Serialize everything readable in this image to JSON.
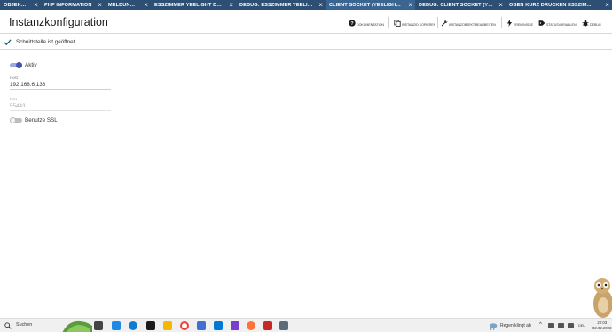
{
  "tabs": [
    {
      "label": "OBJEKTBAUM",
      "active": false
    },
    {
      "label": "PHP INFORMATION",
      "active": false
    },
    {
      "label": "MELDUNGEN",
      "active": false
    },
    {
      "label": "ESSZIMMER YEELIGHT DEVICE",
      "active": false
    },
    {
      "label": "DEBUG: ESSZIMMER YEELIGHT ...",
      "active": false
    },
    {
      "label": "CLIENT SOCKET (YEELIGHTDEV...",
      "active": true
    },
    {
      "label": "DEBUG: CLIENT SOCKET (YEELI...",
      "active": false
    },
    {
      "label": "OBEN KURZ DRÜCKEN ESSZIM...",
      "active": false
    }
  ],
  "header": {
    "title": "Instanzkonfiguration",
    "toolbar": [
      {
        "label": "DOKUMENTATION",
        "icon": "help-icon"
      },
      {
        "label": "INSTANZID KOPIEREN",
        "icon": "copy-icon"
      },
      {
        "label": "INSTANZOBJEKT BEARBEITEN",
        "icon": "wrench-icon"
      },
      {
        "label": "EREIGNISSE",
        "icon": "lightning-icon"
      },
      {
        "label": "STATUSVARIABLEN",
        "icon": "tag-icon"
      },
      {
        "label": "DEBUG",
        "icon": "bug-icon"
      }
    ]
  },
  "status": {
    "text": "Schnittstelle ist geöffnet",
    "icon": "check-icon"
  },
  "form": {
    "active": {
      "label": "Aktiv",
      "on": true
    },
    "host": {
      "label": "Host",
      "value": "192.168.6.138"
    },
    "port": {
      "label": "Port",
      "value": "55443"
    },
    "ssl": {
      "label": "Benutze SSL",
      "on": false
    }
  },
  "taskbar": {
    "search": "Suchen",
    "weather": "Regen klingt ab",
    "lang": "DEU",
    "time": "22:03",
    "date": "02.02.2023"
  },
  "colors": {
    "tabbar": "#2d4f74",
    "tab_active": "#3a6590",
    "accent": "#3f51b5",
    "check": "#1f5f7a"
  }
}
